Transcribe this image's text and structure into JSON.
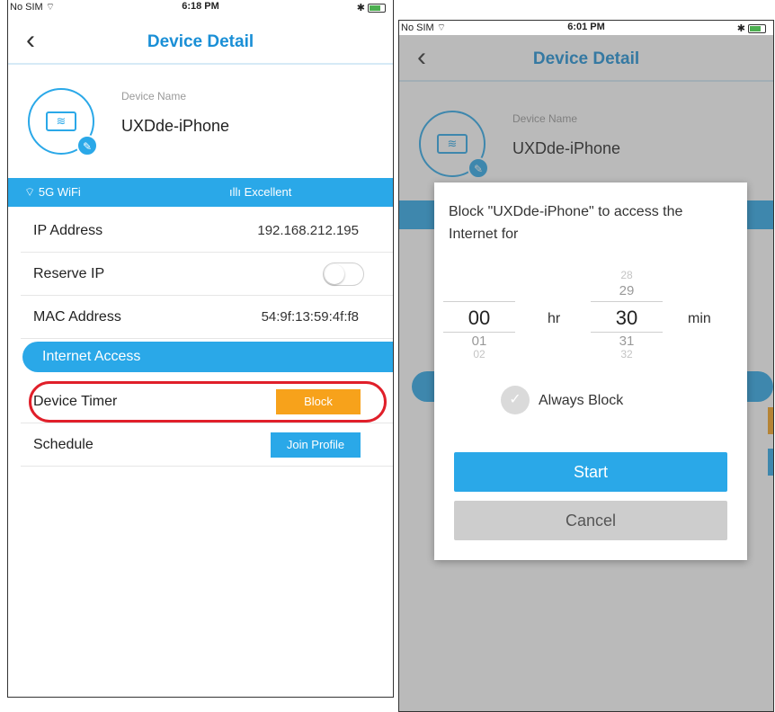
{
  "left": {
    "status": {
      "carrier": "No SIM",
      "time": "6:18 PM"
    },
    "nav": {
      "back": "‹",
      "title": "Device Detail"
    },
    "device": {
      "name_label": "Device Name",
      "name": "UXDde-iPhone"
    },
    "wifi": {
      "band": "5G WiFi",
      "signal": "Excellent"
    },
    "rows": {
      "ip_label": "IP Address",
      "ip_value": "192.168.212.195",
      "reserve_label": "Reserve IP",
      "reserve_on": false,
      "mac_label": "MAC Address",
      "mac_value": "54:9f:13:59:4f:f8"
    },
    "section": "Internet Access",
    "timer": {
      "label": "Device Timer",
      "button": "Block"
    },
    "schedule": {
      "label": "Schedule",
      "button": "Join Profile"
    }
  },
  "right": {
    "status": {
      "carrier": "No SIM",
      "time": "6:01 PM"
    },
    "nav": {
      "back": "‹",
      "title": "Device Detail"
    },
    "device": {
      "name_label": "Device Name",
      "name": "UXDde-iPhone"
    },
    "modal": {
      "message": "Block \"UXDde-iPhone\" to access the Internet for",
      "hours": {
        "selected": "00",
        "after": [
          "01",
          "02"
        ],
        "unit": "hr"
      },
      "minutes": {
        "before": [
          "28",
          "29"
        ],
        "selected": "30",
        "after": [
          "31",
          "32"
        ],
        "unit": "min"
      },
      "always_block": "Always Block",
      "always_block_checked": false,
      "start": "Start",
      "cancel": "Cancel"
    }
  },
  "colors": {
    "accent": "#2aa8e8",
    "title": "#1a8fd6",
    "block": "#f7a21b",
    "highlight": "#e01f2a"
  }
}
